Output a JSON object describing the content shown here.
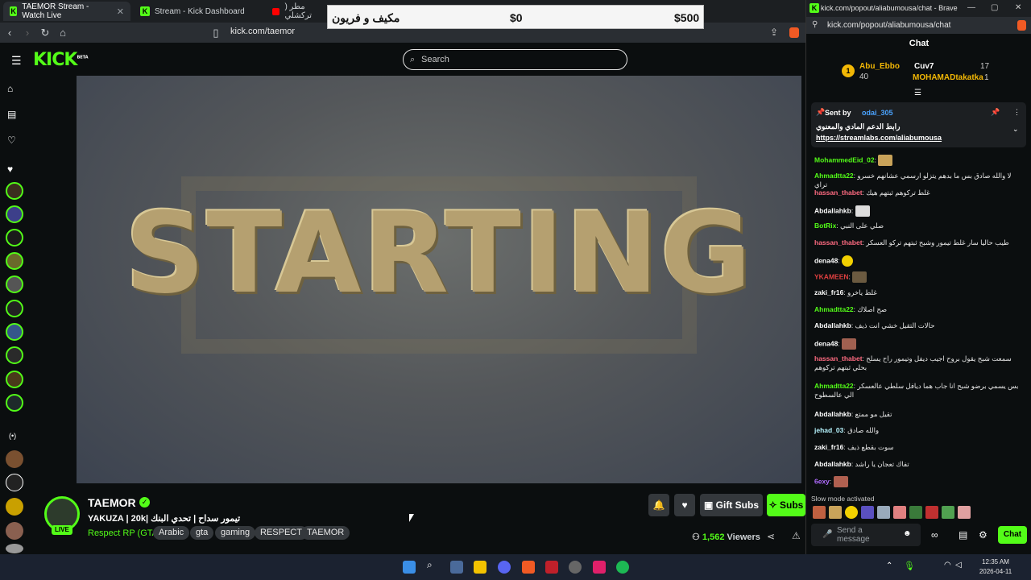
{
  "tabs": [
    {
      "label": "TAEMOR Stream - Watch Live",
      "active": true
    },
    {
      "label": "Stream - Kick Dashboard",
      "active": false
    },
    {
      "label": "مطر ( تركشلي",
      "active": false
    }
  ],
  "address": {
    "url": "kick.com/taemor"
  },
  "overlay": {
    "label": "مكيف و فريون",
    "value1": "$0",
    "value2": "$500"
  },
  "site": {
    "logo": "KICK",
    "logo_badge": "BETA",
    "search_placeholder": "Search",
    "video_text": "STARTING"
  },
  "stream": {
    "channel": "TAEMOR",
    "live": "LIVE",
    "title": "YAKUZA | 20k| تيمور سداح | تحدي البنك",
    "category": "Respect RP (GTA)",
    "tags": [
      "Arabic",
      "gta",
      "gaming",
      "RESPECT",
      "TAEMOR"
    ],
    "gift_subs": "Gift Subs",
    "subs": "Subs",
    "viewer_count": "1,562",
    "viewers_label": "Viewers"
  },
  "chat_window": {
    "title": "kick.com/popout/aliabumousa/chat - Brave",
    "url": "kick.com/popout/aliabumousa/chat",
    "header": "Chat",
    "leaderboard": [
      {
        "rank": "1",
        "name": "Abu_Ebbo",
        "value": "40"
      },
      {
        "name": "Cuv7",
        "value": "17"
      },
      {
        "name": "MOHAMADtakatka",
        "value": "1"
      }
    ],
    "pinned": {
      "sent_by_label": "Sent by",
      "sender": "odai_305",
      "text": "رابط الدعم المادي والمعنوي",
      "link": "https://streamlabs.com/aliabumousa"
    },
    "messages": [
      {
        "user": "MohammedEid_02",
        "text": "",
        "color": "#53fc18"
      },
      {
        "user": "Ahmadtta22",
        "text": "لا والله صادق بس ما بدهم يتزلو ارسمي عشانهم خسرو تراي",
        "color": "#53fc18"
      },
      {
        "user": "hassan_thabet",
        "text": "غلط تركوهم ثبتهم هيك",
        "color": "#ff6b81"
      },
      {
        "user": "Abdallahkb",
        "text": "",
        "color": "#ffffff"
      },
      {
        "user": "BotRix",
        "text": "صلي على النبي",
        "color": "#53fc18"
      },
      {
        "user": "hassan_thabet",
        "text": "طيب حاليا سار غلط تيمور وشبح ثبتهم تركو العسكر",
        "color": "#ff6b81"
      },
      {
        "user": "dena48",
        "text": "",
        "color": "#ffffff"
      },
      {
        "user": "YKAMEEN",
        "text": "",
        "color": "#e04040"
      },
      {
        "user": "zaki_fr16",
        "text": "غلط ياخرو",
        "color": "#ffffff"
      },
      {
        "user": "Ahmadtta22",
        "text": "صح اصلاك",
        "color": "#53fc18"
      },
      {
        "user": "Abdallahkb",
        "text": "حالات التقيل خشي انت ذيف",
        "color": "#ffffff"
      },
      {
        "user": "dena48",
        "text": "",
        "color": "#ffffff"
      },
      {
        "user": "hassan_thabet",
        "text": "سمعت شبح يقول بروح اجيب ديفل وتيمور راح يسلح بحلي ثبتهم تركوهم",
        "color": "#ff6b81"
      },
      {
        "user": "Ahmadtta22",
        "text": "بس يسمي برضو شبح انا جاب هما ديافل سلطي عالعسكر الي عالسطوح",
        "color": "#53fc18"
      },
      {
        "user": "Abdallahkb",
        "text": "تقيل مو ممتع",
        "color": "#ffffff"
      },
      {
        "user": "jehad_03",
        "text": "والله صادق",
        "color": "#b7f5ff"
      },
      {
        "user": "zaki_fr16",
        "text": "سوت بقطع ذيف",
        "color": "#ffffff"
      },
      {
        "user": "Abdallahkb",
        "text": "تفاك تعجان يا راشد",
        "color": "#ffffff"
      },
      {
        "user": "6exy",
        "text": "",
        "color": "#b06cff"
      }
    ],
    "slow_mode": "Slow mode activated",
    "send_placeholder": "Send a message",
    "chat_button": "Chat"
  },
  "taskbar": {
    "time": "12:35 AM",
    "date": "2026-04-11"
  },
  "colors": {
    "kick_green": "#53fc18",
    "bg": "#0b0e0f"
  }
}
